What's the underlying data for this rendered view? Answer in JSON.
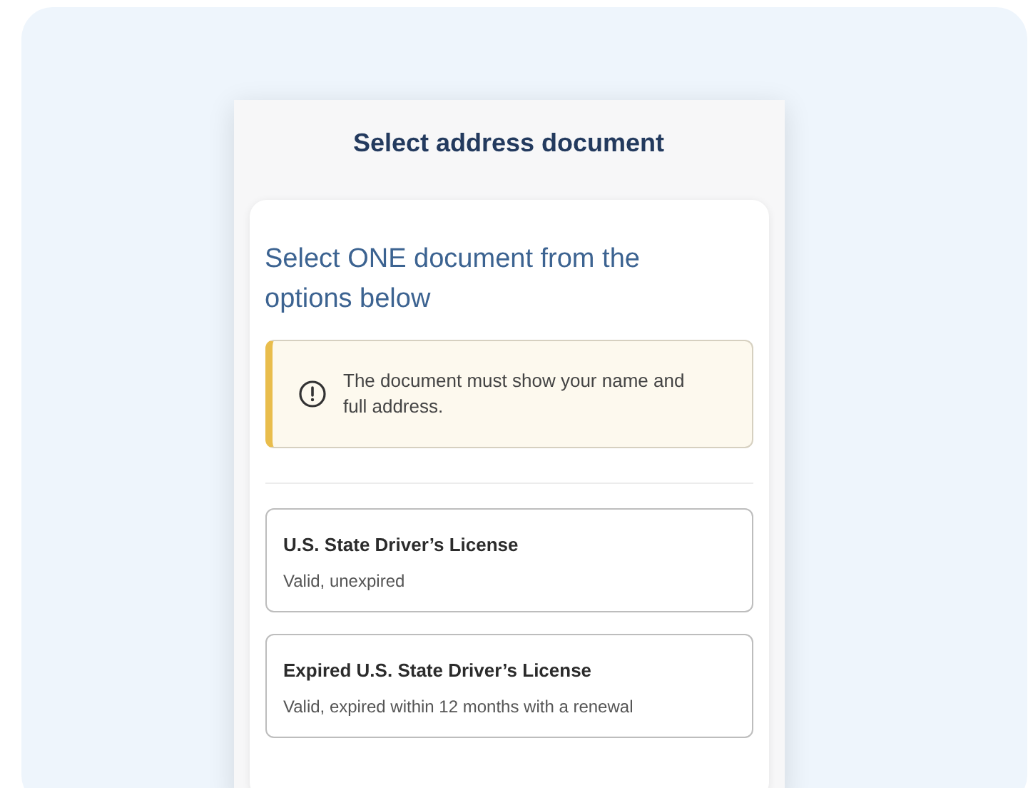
{
  "screen": {
    "title": "Select address document"
  },
  "card": {
    "heading": "Select ONE document from the options below",
    "notice": {
      "text": "The document must show your name and full address."
    },
    "options": [
      {
        "title": "U.S. State Driver’s License",
        "description": "Valid, unexpired"
      },
      {
        "title": "Expired U.S. State Driver’s License",
        "description": "Valid, expired within 12 months with a renewal"
      }
    ]
  }
}
